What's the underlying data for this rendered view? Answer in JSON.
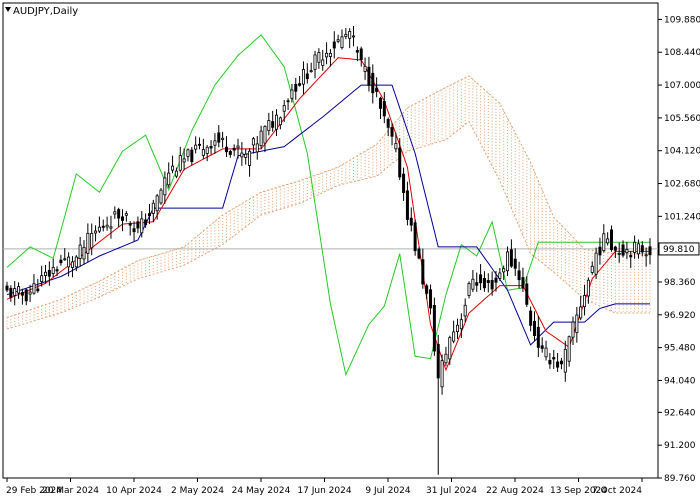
{
  "header": {
    "symbol_title": "AUDJPY,Daily"
  },
  "colors": {
    "background": "#ffffff",
    "frame": "#000000",
    "candle": "#000000",
    "tenkan": "#e00000",
    "kijun": "#0000a0",
    "chikou": "#22cc22",
    "cloud_a": "#e8a070",
    "cloud_b": "#c8c0d8",
    "price_line": "#b0b0b0",
    "price_label_bg": "#ffffff"
  },
  "chart_data": {
    "type": "candlestick",
    "indicator": "Ichimoku Kinko Hyo",
    "timeframe": "Daily",
    "ylim": [
      89.76,
      110.6
    ],
    "y_ticks": [
      "109.880",
      "108.440",
      "107.000",
      "105.560",
      "104.120",
      "102.680",
      "101.240",
      "99.810",
      "98.360",
      "96.920",
      "95.480",
      "94.040",
      "92.640",
      "91.200",
      "89.760"
    ],
    "current_price": "99.810",
    "x_tick_labels": [
      "29 Feb 2024",
      "20 Mar 2024",
      "10 Apr 2024",
      "2 May 2024",
      "24 May 2024",
      "17 Jun 2024",
      "9 Jul 2024",
      "31 Jul 2024",
      "22 Aug 2024",
      "13 Sep 2024",
      "7 Oct 2024"
    ],
    "close_path": [
      [
        0,
        97.9
      ],
      [
        5,
        97.8
      ],
      [
        10,
        98.6
      ],
      [
        14,
        99.2
      ],
      [
        18,
        99.4
      ],
      [
        22,
        100.4
      ],
      [
        26,
        101.0
      ],
      [
        30,
        101.4
      ],
      [
        34,
        100.6
      ],
      [
        38,
        101.6
      ],
      [
        42,
        103.2
      ],
      [
        46,
        103.7
      ],
      [
        50,
        104.2
      ],
      [
        54,
        104.6
      ],
      [
        58,
        104.3
      ],
      [
        62,
        103.8
      ],
      [
        66,
        104.8
      ],
      [
        70,
        105.6
      ],
      [
        74,
        106.8
      ],
      [
        78,
        107.6
      ],
      [
        82,
        108.4
      ],
      [
        86,
        108.9
      ],
      [
        89,
        109.3
      ],
      [
        92,
        107.9
      ],
      [
        95,
        107.0
      ],
      [
        98,
        105.4
      ],
      [
        101,
        104.1
      ],
      [
        104,
        101.4
      ],
      [
        107,
        99.2
      ],
      [
        110,
        97.0
      ],
      [
        112,
        94.1
      ],
      [
        115,
        95.9
      ],
      [
        118,
        96.9
      ],
      [
        121,
        98.6
      ],
      [
        124,
        98.1
      ],
      [
        127,
        98.4
      ],
      [
        130,
        99.5
      ],
      [
        133,
        98.7
      ],
      [
        136,
        96.6
      ],
      [
        139,
        95.2
      ],
      [
        142,
        95.0
      ],
      [
        144,
        94.6
      ],
      [
        147,
        96.3
      ],
      [
        150,
        97.9
      ],
      [
        153,
        99.6
      ],
      [
        156,
        100.4
      ],
      [
        158,
        99.81
      ]
    ],
    "tenkan_path": [
      [
        0,
        97.6
      ],
      [
        10,
        98.3
      ],
      [
        20,
        99.6
      ],
      [
        30,
        100.9
      ],
      [
        38,
        101.0
      ],
      [
        46,
        103.3
      ],
      [
        56,
        104.2
      ],
      [
        66,
        104.2
      ],
      [
        76,
        106.4
      ],
      [
        86,
        108.2
      ],
      [
        92,
        108.1
      ],
      [
        98,
        106.3
      ],
      [
        104,
        103.4
      ],
      [
        110,
        96.5
      ],
      [
        114,
        94.5
      ],
      [
        120,
        97.0
      ],
      [
        128,
        98.2
      ],
      [
        134,
        98.2
      ],
      [
        140,
        96.2
      ],
      [
        146,
        95.5
      ],
      [
        152,
        98.5
      ],
      [
        158,
        99.7
      ]
    ],
    "kijun_path": [
      [
        0,
        97.8
      ],
      [
        14,
        98.6
      ],
      [
        24,
        99.5
      ],
      [
        34,
        100.2
      ],
      [
        38,
        101.6
      ],
      [
        56,
        101.6
      ],
      [
        60,
        103.9
      ],
      [
        72,
        104.3
      ],
      [
        82,
        105.6
      ],
      [
        92,
        107.0
      ],
      [
        100,
        107.0
      ],
      [
        106,
        104.0
      ],
      [
        112,
        99.9
      ],
      [
        122,
        99.9
      ],
      [
        130,
        98.0
      ],
      [
        136,
        95.6
      ],
      [
        142,
        96.6
      ],
      [
        150,
        96.6
      ],
      [
        154,
        97.2
      ],
      [
        158,
        97.4
      ]
    ],
    "chikou_path": [
      [
        0,
        99.0
      ],
      [
        6,
        99.9
      ],
      [
        12,
        99.4
      ],
      [
        18,
        103.1
      ],
      [
        24,
        102.3
      ],
      [
        30,
        104.1
      ],
      [
        36,
        104.8
      ],
      [
        42,
        102.4
      ],
      [
        48,
        105.0
      ],
      [
        54,
        107.0
      ],
      [
        60,
        108.3
      ],
      [
        66,
        109.2
      ],
      [
        72,
        107.8
      ],
      [
        78,
        104.0
      ],
      [
        84,
        97.4
      ],
      [
        88,
        94.3
      ],
      [
        94,
        96.5
      ],
      [
        98,
        97.3
      ],
      [
        102,
        99.6
      ],
      [
        106,
        95.1
      ],
      [
        110,
        95.0
      ],
      [
        114,
        97.8
      ],
      [
        118,
        100.0
      ],
      [
        122,
        99.5
      ],
      [
        126,
        101.0
      ],
      [
        130,
        98.0
      ],
      [
        134,
        98.1
      ],
      [
        138,
        100.1
      ]
    ],
    "span_a_path": [
      [
        0,
        96.8
      ],
      [
        14,
        97.6
      ],
      [
        24,
        98.4
      ],
      [
        34,
        99.3
      ],
      [
        46,
        99.9
      ],
      [
        56,
        101.3
      ],
      [
        66,
        102.3
      ],
      [
        76,
        102.8
      ],
      [
        86,
        103.4
      ],
      [
        96,
        104.4
      ],
      [
        104,
        106.0
      ],
      [
        114,
        106.9
      ],
      [
        120,
        107.4
      ],
      [
        128,
        106.2
      ],
      [
        136,
        103.6
      ],
      [
        142,
        101.2
      ],
      [
        150,
        99.8
      ],
      [
        158,
        99.6
      ]
    ],
    "span_b_path": [
      [
        0,
        96.3
      ],
      [
        14,
        97.0
      ],
      [
        24,
        97.7
      ],
      [
        34,
        98.5
      ],
      [
        46,
        99.1
      ],
      [
        56,
        100.0
      ],
      [
        66,
        101.3
      ],
      [
        76,
        101.8
      ],
      [
        86,
        102.6
      ],
      [
        96,
        103.0
      ],
      [
        104,
        104.1
      ],
      [
        114,
        104.6
      ],
      [
        120,
        105.4
      ],
      [
        128,
        102.8
      ],
      [
        136,
        99.6
      ],
      [
        142,
        98.8
      ],
      [
        150,
        97.6
      ],
      [
        158,
        97.0
      ]
    ]
  }
}
